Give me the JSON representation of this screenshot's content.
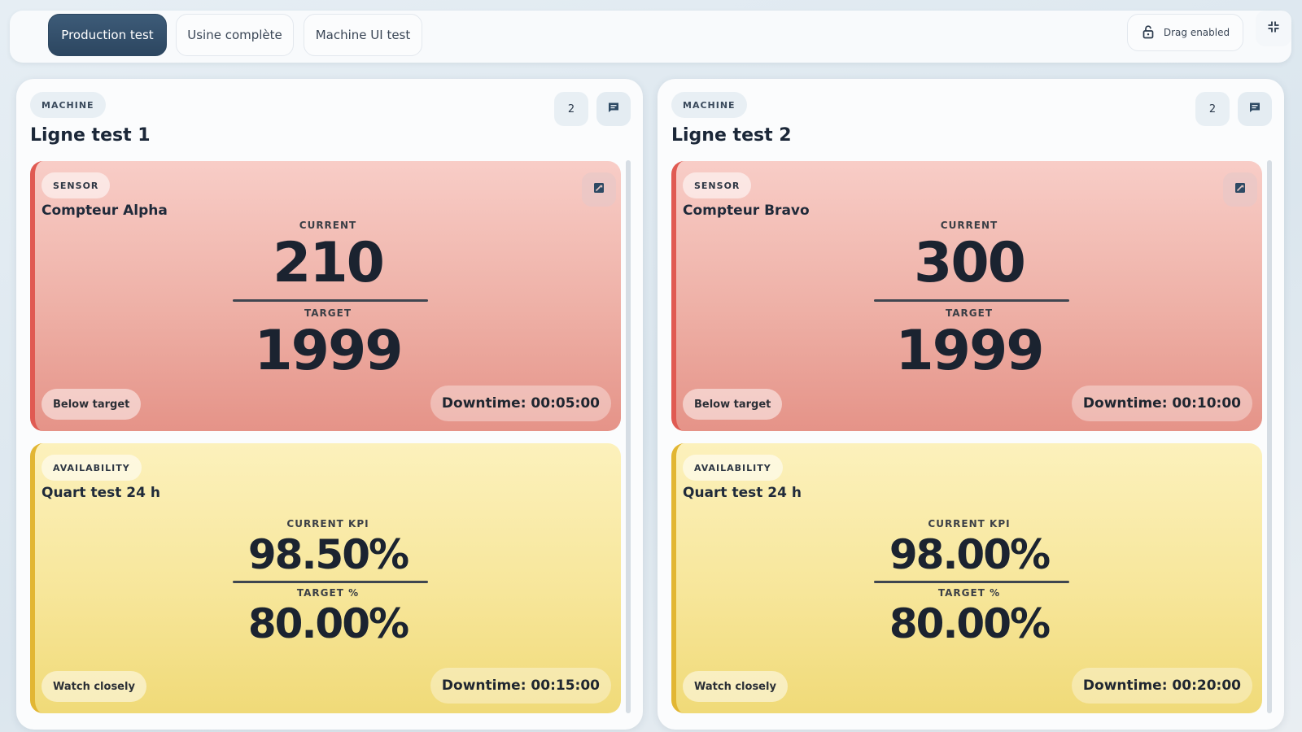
{
  "colors": {
    "tab_active": "#2c4660",
    "sensor_card": "#f0b0a8",
    "sensor_accent": "#e05a52",
    "availability_card": "#f7e69a",
    "availability_accent": "#e2b633"
  },
  "header": {
    "tabs": [
      {
        "label": "Production test",
        "active": true
      },
      {
        "label": "Usine complète",
        "active": false
      },
      {
        "label": "Machine UI test",
        "active": false
      }
    ],
    "drag_label": "Drag enabled",
    "drag_icon": "lock-open-icon",
    "collapse_icon": "collapse-icon"
  },
  "panels": [
    {
      "type": "MACHINE",
      "title": "Ligne test 1",
      "count": "2",
      "sensor": {
        "type": "SENSOR",
        "title": "Compteur Alpha",
        "current_label": "CURRENT",
        "current": "210",
        "target_label": "TARGET",
        "target": "1999",
        "status": "Below target",
        "downtime": "Downtime: 00:05:00"
      },
      "availability": {
        "type": "AVAILABILITY",
        "title": "Quart test 24 h",
        "current_label": "CURRENT KPI",
        "current": "98.50%",
        "target_label": "TARGET %",
        "target": "80.00%",
        "status": "Watch closely",
        "downtime": "Downtime: 00:15:00"
      }
    },
    {
      "type": "MACHINE",
      "title": "Ligne test 2",
      "count": "2",
      "sensor": {
        "type": "SENSOR",
        "title": "Compteur Bravo",
        "current_label": "CURRENT",
        "current": "300",
        "target_label": "TARGET",
        "target": "1999",
        "status": "Below target",
        "downtime": "Downtime: 00:10:00"
      },
      "availability": {
        "type": "AVAILABILITY",
        "title": "Quart test 24 h",
        "current_label": "CURRENT KPI",
        "current": "98.00%",
        "target_label": "TARGET %",
        "target": "80.00%",
        "status": "Watch closely",
        "downtime": "Downtime: 00:20:00"
      }
    }
  ]
}
